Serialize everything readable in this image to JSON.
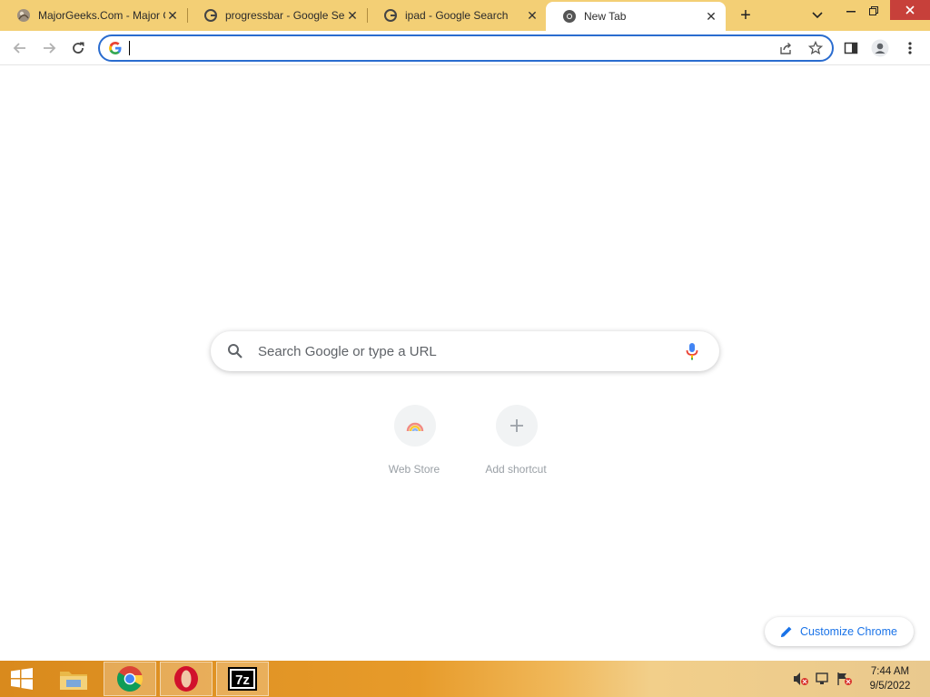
{
  "tabs": [
    {
      "title": "MajorGeeks.Com - Major Geeks",
      "favicon": "majorgeeks-icon"
    },
    {
      "title": "progressbar - Google Search",
      "favicon": "google-icon"
    },
    {
      "title": "ipad - Google Search",
      "favicon": "google-icon"
    },
    {
      "title": "New Tab",
      "favicon": "chrome-icon",
      "active": true
    }
  ],
  "omnibox": {
    "value": ""
  },
  "ntp": {
    "search_placeholder": "Search Google or type a URL",
    "shortcuts": [
      {
        "label": "Web Store",
        "icon": "web-store-icon"
      },
      {
        "label": "Add shortcut",
        "icon": "plus-icon"
      }
    ],
    "customize_label": "Customize Chrome"
  },
  "taskbar": {
    "items": [
      "file-explorer-icon",
      "chrome-icon",
      "opera-icon",
      "7zip-icon"
    ],
    "clock_time": "7:44 AM",
    "clock_date": "9/5/2022"
  },
  "colors": {
    "tabstrip": "#f3cf75",
    "accent": "#1a73e8",
    "omnibox_border": "#2a6ccf"
  }
}
